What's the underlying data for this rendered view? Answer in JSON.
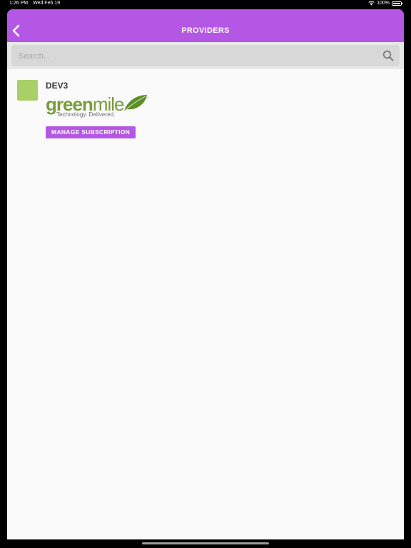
{
  "status_bar": {
    "time": "1:26 PM",
    "date": "Wed Feb 19",
    "battery": "100%",
    "wifi_icon": "wifi-icon",
    "battery_icon": "battery-icon"
  },
  "navbar": {
    "title": "PROVIDERS",
    "back_icon": "chevron-left-icon",
    "background_color": "#b557e5"
  },
  "search": {
    "placeholder": "Search...",
    "value": "",
    "icon": "search-icon"
  },
  "providers": [
    {
      "name": "DEV3",
      "swatch_color": "#a9cf67",
      "logo": {
        "word_bold": "green",
        "word_light": "mile",
        "tagline": "Technology. Delivered.",
        "leaf_icon": "leaf-icon"
      },
      "action_label": "MANAGE SUBSCRIPTION"
    }
  ],
  "colors": {
    "accent": "#b557e5",
    "brand_green": "#7a9b3c"
  }
}
